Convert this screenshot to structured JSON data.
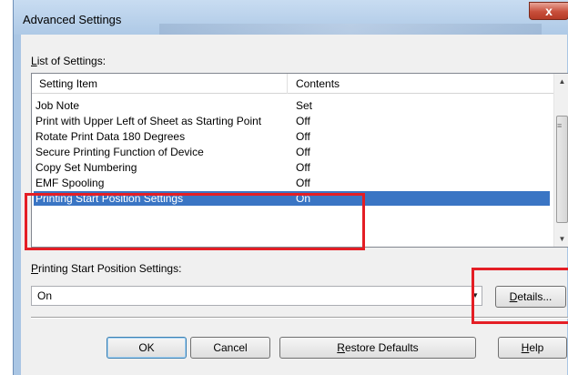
{
  "window": {
    "title": "Advanced Settings",
    "close_glyph": "x"
  },
  "list": {
    "label_accel": "L",
    "label_rest": "ist of Settings:",
    "columns": [
      "Setting Item",
      "Contents"
    ],
    "rows": [
      {
        "item": "Job Note",
        "contents": "Set"
      },
      {
        "item": "Print with Upper Left of Sheet as Starting Point",
        "contents": "Off"
      },
      {
        "item": "Rotate Print Data 180 Degrees",
        "contents": "Off"
      },
      {
        "item": "Secure Printing Function of Device",
        "contents": "Off"
      },
      {
        "item": "Copy Set Numbering",
        "contents": "Off"
      },
      {
        "item": "EMF Spooling",
        "contents": "Off"
      },
      {
        "item": "Printing Start Position Settings",
        "contents": "On",
        "selected": true
      }
    ]
  },
  "setting_detail": {
    "label_accel": "P",
    "label_rest": "rinting Start Position Settings:",
    "value": "On",
    "details_accel": "D",
    "details_rest": "etails..."
  },
  "buttons": {
    "ok": "OK",
    "cancel": "Cancel",
    "restore_accel": "R",
    "restore_rest": "estore Defaults",
    "help_accel": "H",
    "help_rest": "elp"
  },
  "icons": {
    "close": "close-icon",
    "scroll_up": "scroll-up-arrow-icon",
    "scroll_down": "scroll-down-arrow-icon",
    "combo": "chevron-down-icon"
  },
  "colors": {
    "selection": "#3a75c4",
    "highlight": "#e41e25",
    "close_button": "#c84f3b"
  }
}
